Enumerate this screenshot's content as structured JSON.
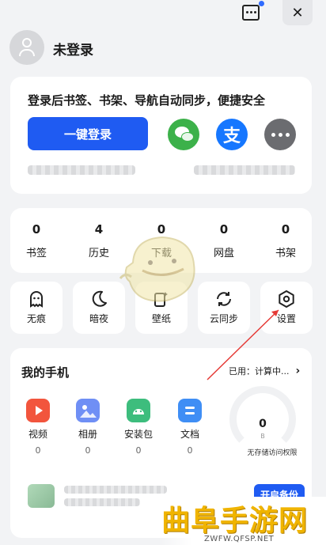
{
  "user": {
    "name": "未登录"
  },
  "login": {
    "description": "登录后书签、书架、导航自动同步，便捷安全",
    "one_click_label": "一键登录",
    "alipay_glyph": "支"
  },
  "stats": [
    {
      "count": "0",
      "label": "书签"
    },
    {
      "count": "4",
      "label": "历史"
    },
    {
      "count": "0",
      "label": "下载"
    },
    {
      "count": "0",
      "label": "网盘"
    },
    {
      "count": "0",
      "label": "书架"
    }
  ],
  "tools": [
    {
      "label": "无痕",
      "icon": "ghost-icon"
    },
    {
      "label": "暗夜",
      "icon": "moon-icon"
    },
    {
      "label": "壁纸",
      "icon": "wallpaper-icon"
    },
    {
      "label": "云同步",
      "icon": "sync-icon"
    },
    {
      "label": "设置",
      "icon": "settings-icon"
    }
  ],
  "phone": {
    "title": "我的手机",
    "used": "已用：计算中...",
    "chevron": "›",
    "apps": [
      {
        "label": "视频",
        "count": "0",
        "color": "#f2553d",
        "icon": "video-icon"
      },
      {
        "label": "相册",
        "count": "0",
        "color": "#6f8ff5",
        "icon": "album-icon"
      },
      {
        "label": "安装包",
        "count": "0",
        "color": "#3dbd7d",
        "icon": "package-icon"
      },
      {
        "label": "文档",
        "count": "0",
        "color": "#3f8ef5",
        "icon": "document-icon"
      }
    ],
    "gauge_value": "0",
    "gauge_unit": "B",
    "gauge_caption": "无存储访问权限",
    "backup_label": "开启备份"
  },
  "watermark": {
    "title": "曲阜手游网",
    "url": "ZWFW.QFSP.NET"
  },
  "colors": {
    "accent": "#1f5bf2",
    "wechat": "#3cb14a",
    "alipay": "#1677ff",
    "annotation": "#e53935"
  }
}
